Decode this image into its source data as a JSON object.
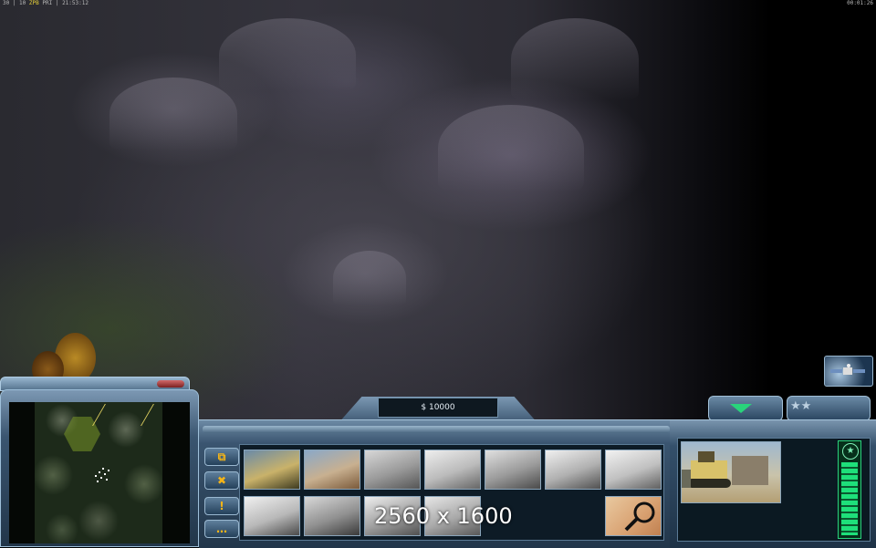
{
  "hud": {
    "top_left_stats": "30 | 10",
    "top_left_highlight": "ZPB",
    "top_left_rest": "PRI | 21:53:12",
    "top_right_timer": "00:01:26"
  },
  "resources": {
    "money": "$ 10000"
  },
  "command_bar": {
    "side_buttons": [
      {
        "name": "structures-tab",
        "icon": "window-stack-icon",
        "glyph": "⧉"
      },
      {
        "name": "repair-tab",
        "icon": "tools-icon",
        "glyph": "✖"
      },
      {
        "name": "alert-tab",
        "icon": "warning-icon",
        "glyph": "!"
      },
      {
        "name": "chat-tab",
        "icon": "chat-bubble-icon",
        "glyph": "…"
      }
    ],
    "build_slots_row1": [
      {
        "name": "command-center",
        "colors": [
          "#6a8aa8",
          "#c9b26a",
          "#3d3a20"
        ]
      },
      {
        "name": "barracks",
        "colors": [
          "#8aa8c8",
          "#c8b090",
          "#7b5a3a"
        ]
      },
      {
        "name": "war-factory",
        "colors": [
          "#d8d8d8",
          "#9a9a9a",
          "#555555"
        ]
      },
      {
        "name": "patriot-battery",
        "colors": [
          "#eeeeee",
          "#bbbbbb",
          "#666666"
        ]
      },
      {
        "name": "particle-cannon",
        "colors": [
          "#e0e0e0",
          "#9a9a9a",
          "#4a4a4a"
        ]
      },
      {
        "name": "supply-center",
        "colors": [
          "#f0f0f0",
          "#b0b0b0",
          "#505050"
        ]
      },
      {
        "name": "airfield",
        "colors": [
          "#f2f2f2",
          "#c0c0c0",
          "#606060"
        ]
      }
    ],
    "build_slots_row2": [
      {
        "name": "power-plant",
        "colors": [
          "#f0f0f0",
          "#b8b8b8",
          "#4a4a4a"
        ]
      },
      {
        "name": "strategy-center",
        "colors": [
          "#d8d8d8",
          "#909090",
          "#3a3a3a"
        ]
      },
      {
        "name": "fire-base",
        "colors": [
          "#eeeeee",
          "#a0a0a0",
          "#505050"
        ]
      },
      {
        "name": "detention-camp",
        "colors": [
          "#e6e6e6",
          "#a8a8a8",
          "#585858"
        ]
      }
    ],
    "special_slot": {
      "name": "sell-structure",
      "icon": "magnifier-sell-icon"
    },
    "watermark": "2560 x 1600"
  },
  "unit_panel": {
    "portrait": "dozer-unit",
    "health_fraction": 0.8,
    "rank_icon_glyph": "★"
  },
  "general_controls": {
    "generals_powers_glyph": "★★",
    "satellite_icon": "satellite-icon"
  },
  "colors": {
    "ui_metal": "#4d6b86",
    "ui_dark": "#0c1820",
    "accent_green": "#29d47b",
    "accent_yellow": "#f4b418"
  }
}
